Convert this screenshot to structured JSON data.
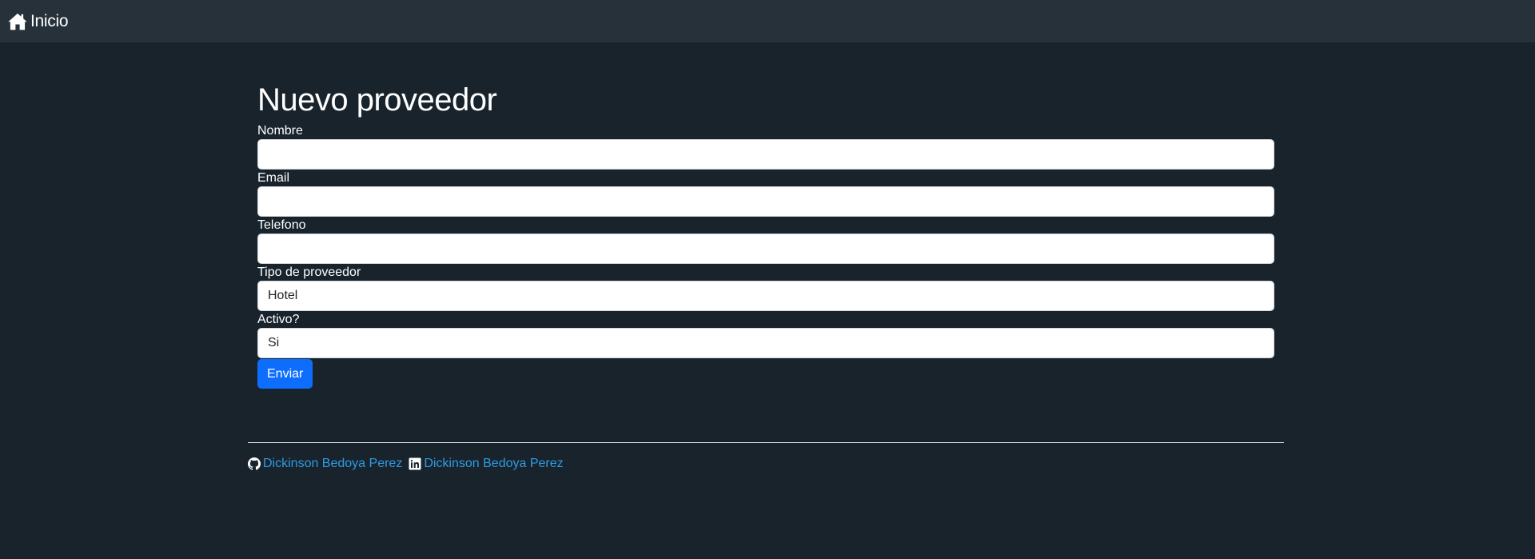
{
  "navbar": {
    "brand_label": "Inicio"
  },
  "form": {
    "title": "Nuevo proveedor",
    "fields": [
      {
        "label": "Nombre",
        "value": ""
      },
      {
        "label": "Email",
        "value": ""
      },
      {
        "label": "Telefono",
        "value": ""
      },
      {
        "label": "Tipo de proveedor",
        "value": "Hotel"
      },
      {
        "label": "Activo?",
        "value": "Si"
      }
    ],
    "submit_label": "Enviar"
  },
  "footer": {
    "github_label": "Dickinson Bedoya Perez",
    "linkedin_label": "Dickinson Bedoya Perez"
  },
  "colors": {
    "background": "#18232c",
    "navbar": "#263139",
    "primary": "#0d6efd",
    "link": "#2f9be4"
  }
}
